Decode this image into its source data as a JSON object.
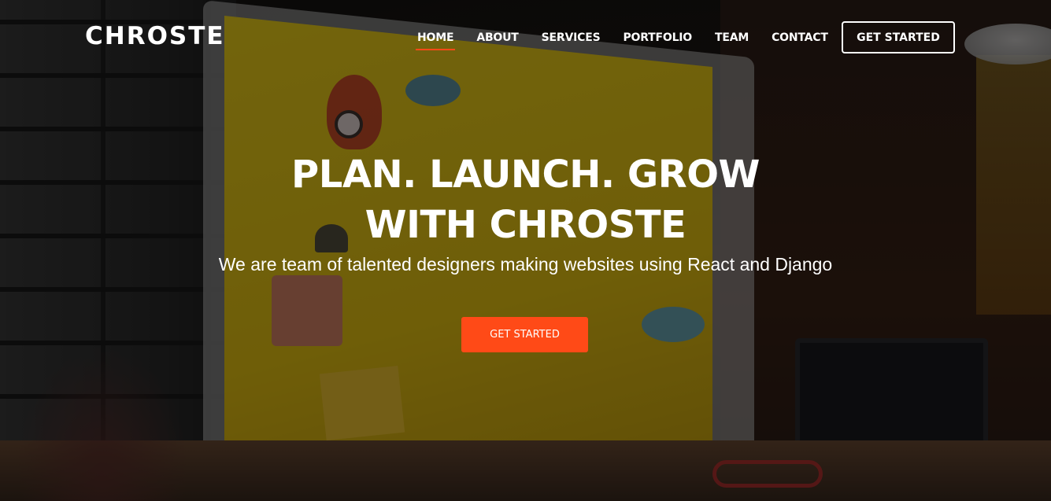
{
  "brand": {
    "logo": "CHROSTE",
    "accent_color": "#ff4a17"
  },
  "nav": {
    "items": [
      {
        "label": "HOME",
        "active": true
      },
      {
        "label": "ABOUT",
        "active": false
      },
      {
        "label": "SERVICES",
        "active": false
      },
      {
        "label": "PORTFOLIO",
        "active": false
      },
      {
        "label": "TEAM",
        "active": false
      },
      {
        "label": "CONTACT",
        "active": false
      }
    ],
    "cta_label": "GET STARTED"
  },
  "hero": {
    "title_line1": "PLAN. LAUNCH. GROW",
    "title_line2": "WITH CHROSTE",
    "subtitle": "We are team of talented designers making websites using React and Django",
    "cta_label": "GET STARTED"
  }
}
